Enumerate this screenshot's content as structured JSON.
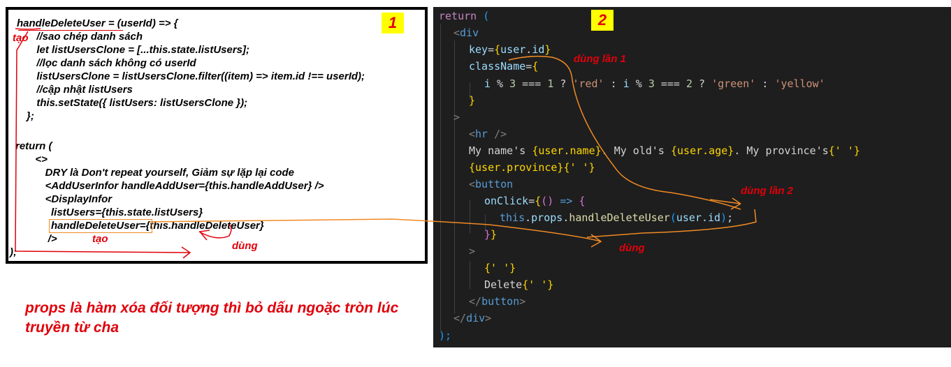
{
  "left_panel": {
    "badge": "1",
    "lines": [
      "handleDeleteUser = (userId) => {",
      "  //sao chép danh sách",
      "  let listUsersClone = [...this.state.listUsers];",
      "  //lọc danh sách không có userId",
      "  listUsersClone = listUsersClone.filter((item) => item.id !== userId);",
      "  //cập nhật listUsers",
      "  this.setState({ listUsers: listUsersClone });",
      "};",
      "",
      "return (",
      "  <>",
      "    DRY là Don't repeat yourself, Giảm sự lặp lại code",
      "    <AddUserInfor handleAddUser={this.handleAddUser} />",
      "    <DisplayInfor",
      "      listUsers={this.state.listUsers}",
      "      handleDeleteUser={this.handleDeleteUser}",
      "    />",
      ");"
    ],
    "annotations": {
      "tao_top": "tạo",
      "tao_bottom": "tạo",
      "dung": "dùng"
    }
  },
  "note": "props là hàm xóa đối tượng thì bỏ dấu ngoặc tròn lúc truyền từ cha",
  "right_panel": {
    "badge": "2",
    "annotations": {
      "dung_lan_1": "dùng lần 1",
      "dung_lan_2": "dùng lần 2",
      "dung": "dùng"
    },
    "code": {
      "l1": {
        "kw": "return",
        "p": " ("
      },
      "l2": {
        "tag": "<",
        "name": "div"
      },
      "l3": {
        "attr": "key",
        "eq": "=",
        "ob": "{",
        "v": "user",
        "dot": ".",
        "p": "id",
        "cb": "}"
      },
      "l4": {
        "attr": "className",
        "eq": "=",
        "ob": "{"
      },
      "l5": {
        "a": "i",
        "o1": " % ",
        "n1": "3",
        "o2": " === ",
        "n2": "1",
        "o3": " ? ",
        "s1": "'red'",
        "o4": " : ",
        "b": "i",
        "o5": " % ",
        "n3": "3",
        "o6": " === ",
        "n4": "2",
        "o7": " ? ",
        "s2": "'green'",
        "o8": " : ",
        "s3": "'yellow'"
      },
      "l6": {
        "cb": "}"
      },
      "l7": {
        "gt": ">"
      },
      "l8": {
        "lt": "<",
        "name": "hr",
        "end": " />"
      },
      "l9": {
        "t1": "My name's ",
        "e1": "{user.name}",
        "t2": ". My old's ",
        "e2": "{user.age}",
        "t3": ". My province's",
        "e3": "{' '}"
      },
      "l10": {
        "e1": "{user.province}",
        "e2": "{' '}"
      },
      "l11": {
        "lt": "<",
        "name": "button"
      },
      "l12": {
        "attr": "onClick",
        "eq": "=",
        "ob": "{",
        "p1": "()",
        "arrow": " => ",
        "ob2": "{"
      },
      "l13": {
        "this": "this",
        "d1": ".",
        "props": "props",
        "d2": ".",
        "fn": "handleDeleteUser",
        "op": "(",
        "arg": "user.id",
        "cp": ")",
        "semi": ";"
      },
      "l14": {
        "cb2": "}",
        "cb": "}"
      },
      "l15": {
        "gt": ">"
      },
      "l16": {
        "e": "{' '}"
      },
      "l17": {
        "t": "Delete",
        "e": "{' '}"
      },
      "l18": {
        "lt": "</",
        "name": "button",
        "gt": ">"
      },
      "l19": {
        "lt": "</",
        "name": "div",
        "gt": ">"
      },
      "l20": {
        "p": ");"
      }
    }
  },
  "colors": {
    "annotation_red": "#e0000a",
    "annotation_orange": "#f08a24",
    "badge_yellow": "#ffff00",
    "editor_bg": "#1e1e1e"
  }
}
